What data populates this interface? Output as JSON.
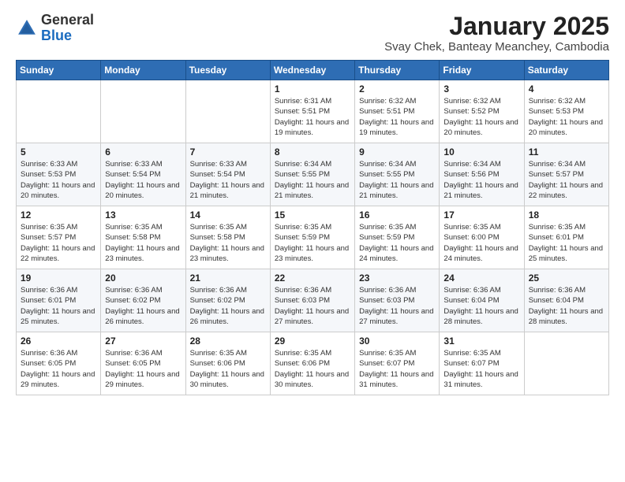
{
  "header": {
    "logo_general": "General",
    "logo_blue": "Blue",
    "title": "January 2025",
    "subtitle": "Svay Chek, Banteay Meanchey, Cambodia"
  },
  "days_of_week": [
    "Sunday",
    "Monday",
    "Tuesday",
    "Wednesday",
    "Thursday",
    "Friday",
    "Saturday"
  ],
  "weeks": [
    [
      {
        "day": "",
        "info": ""
      },
      {
        "day": "",
        "info": ""
      },
      {
        "day": "",
        "info": ""
      },
      {
        "day": "1",
        "info": "Sunrise: 6:31 AM\nSunset: 5:51 PM\nDaylight: 11 hours and 19 minutes."
      },
      {
        "day": "2",
        "info": "Sunrise: 6:32 AM\nSunset: 5:51 PM\nDaylight: 11 hours and 19 minutes."
      },
      {
        "day": "3",
        "info": "Sunrise: 6:32 AM\nSunset: 5:52 PM\nDaylight: 11 hours and 20 minutes."
      },
      {
        "day": "4",
        "info": "Sunrise: 6:32 AM\nSunset: 5:53 PM\nDaylight: 11 hours and 20 minutes."
      }
    ],
    [
      {
        "day": "5",
        "info": "Sunrise: 6:33 AM\nSunset: 5:53 PM\nDaylight: 11 hours and 20 minutes."
      },
      {
        "day": "6",
        "info": "Sunrise: 6:33 AM\nSunset: 5:54 PM\nDaylight: 11 hours and 20 minutes."
      },
      {
        "day": "7",
        "info": "Sunrise: 6:33 AM\nSunset: 5:54 PM\nDaylight: 11 hours and 21 minutes."
      },
      {
        "day": "8",
        "info": "Sunrise: 6:34 AM\nSunset: 5:55 PM\nDaylight: 11 hours and 21 minutes."
      },
      {
        "day": "9",
        "info": "Sunrise: 6:34 AM\nSunset: 5:55 PM\nDaylight: 11 hours and 21 minutes."
      },
      {
        "day": "10",
        "info": "Sunrise: 6:34 AM\nSunset: 5:56 PM\nDaylight: 11 hours and 21 minutes."
      },
      {
        "day": "11",
        "info": "Sunrise: 6:34 AM\nSunset: 5:57 PM\nDaylight: 11 hours and 22 minutes."
      }
    ],
    [
      {
        "day": "12",
        "info": "Sunrise: 6:35 AM\nSunset: 5:57 PM\nDaylight: 11 hours and 22 minutes."
      },
      {
        "day": "13",
        "info": "Sunrise: 6:35 AM\nSunset: 5:58 PM\nDaylight: 11 hours and 23 minutes."
      },
      {
        "day": "14",
        "info": "Sunrise: 6:35 AM\nSunset: 5:58 PM\nDaylight: 11 hours and 23 minutes."
      },
      {
        "day": "15",
        "info": "Sunrise: 6:35 AM\nSunset: 5:59 PM\nDaylight: 11 hours and 23 minutes."
      },
      {
        "day": "16",
        "info": "Sunrise: 6:35 AM\nSunset: 5:59 PM\nDaylight: 11 hours and 24 minutes."
      },
      {
        "day": "17",
        "info": "Sunrise: 6:35 AM\nSunset: 6:00 PM\nDaylight: 11 hours and 24 minutes."
      },
      {
        "day": "18",
        "info": "Sunrise: 6:35 AM\nSunset: 6:01 PM\nDaylight: 11 hours and 25 minutes."
      }
    ],
    [
      {
        "day": "19",
        "info": "Sunrise: 6:36 AM\nSunset: 6:01 PM\nDaylight: 11 hours and 25 minutes."
      },
      {
        "day": "20",
        "info": "Sunrise: 6:36 AM\nSunset: 6:02 PM\nDaylight: 11 hours and 26 minutes."
      },
      {
        "day": "21",
        "info": "Sunrise: 6:36 AM\nSunset: 6:02 PM\nDaylight: 11 hours and 26 minutes."
      },
      {
        "day": "22",
        "info": "Sunrise: 6:36 AM\nSunset: 6:03 PM\nDaylight: 11 hours and 27 minutes."
      },
      {
        "day": "23",
        "info": "Sunrise: 6:36 AM\nSunset: 6:03 PM\nDaylight: 11 hours and 27 minutes."
      },
      {
        "day": "24",
        "info": "Sunrise: 6:36 AM\nSunset: 6:04 PM\nDaylight: 11 hours and 28 minutes."
      },
      {
        "day": "25",
        "info": "Sunrise: 6:36 AM\nSunset: 6:04 PM\nDaylight: 11 hours and 28 minutes."
      }
    ],
    [
      {
        "day": "26",
        "info": "Sunrise: 6:36 AM\nSunset: 6:05 PM\nDaylight: 11 hours and 29 minutes."
      },
      {
        "day": "27",
        "info": "Sunrise: 6:36 AM\nSunset: 6:05 PM\nDaylight: 11 hours and 29 minutes."
      },
      {
        "day": "28",
        "info": "Sunrise: 6:35 AM\nSunset: 6:06 PM\nDaylight: 11 hours and 30 minutes."
      },
      {
        "day": "29",
        "info": "Sunrise: 6:35 AM\nSunset: 6:06 PM\nDaylight: 11 hours and 30 minutes."
      },
      {
        "day": "30",
        "info": "Sunrise: 6:35 AM\nSunset: 6:07 PM\nDaylight: 11 hours and 31 minutes."
      },
      {
        "day": "31",
        "info": "Sunrise: 6:35 AM\nSunset: 6:07 PM\nDaylight: 11 hours and 31 minutes."
      },
      {
        "day": "",
        "info": ""
      }
    ]
  ]
}
